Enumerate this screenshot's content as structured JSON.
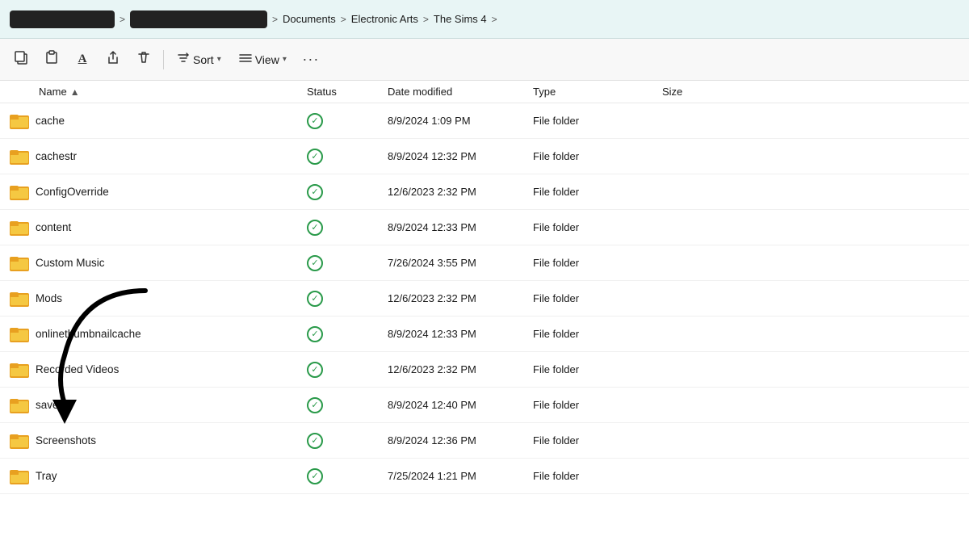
{
  "addressBar": {
    "redacted1": "",
    "redacted2": "",
    "chevron": ">",
    "crumbs": [
      "Documents",
      "Electronic Arts",
      "The Sims 4"
    ]
  },
  "toolbar": {
    "copyIcon": "❐",
    "pasteIcon": "❑",
    "renameIcon": "A",
    "shareIcon": "↗",
    "deleteIcon": "🗑",
    "sortLabel": "Sort",
    "viewLabel": "View",
    "moreLabel": "···"
  },
  "columns": {
    "name": "Name",
    "status": "Status",
    "dateModified": "Date modified",
    "type": "Type",
    "size": "Size"
  },
  "files": [
    {
      "name": "cache",
      "status": "✓",
      "date": "8/9/2024 1:09 PM",
      "type": "File folder"
    },
    {
      "name": "cachestr",
      "status": "✓",
      "date": "8/9/2024 12:32 PM",
      "type": "File folder"
    },
    {
      "name": "ConfigOverride",
      "status": "✓",
      "date": "12/6/2023 2:32 PM",
      "type": "File folder"
    },
    {
      "name": "content",
      "status": "✓",
      "date": "8/9/2024 12:33 PM",
      "type": "File folder"
    },
    {
      "name": "Custom Music",
      "status": "✓",
      "date": "7/26/2024 3:55 PM",
      "type": "File folder"
    },
    {
      "name": "Mods",
      "status": "✓",
      "date": "12/6/2023 2:32 PM",
      "type": "File folder"
    },
    {
      "name": "onlinethumbnailcache",
      "status": "✓",
      "date": "8/9/2024 12:33 PM",
      "type": "File folder"
    },
    {
      "name": "Recorded Videos",
      "status": "✓",
      "date": "12/6/2023 2:32 PM",
      "type": "File folder"
    },
    {
      "name": "saves",
      "status": "✓",
      "date": "8/9/2024 12:40 PM",
      "type": "File folder"
    },
    {
      "name": "Screenshots",
      "status": "✓",
      "date": "8/9/2024 12:36 PM",
      "type": "File folder"
    },
    {
      "name": "Tray",
      "status": "✓",
      "date": "7/25/2024 1:21 PM",
      "type": "File folder"
    }
  ]
}
